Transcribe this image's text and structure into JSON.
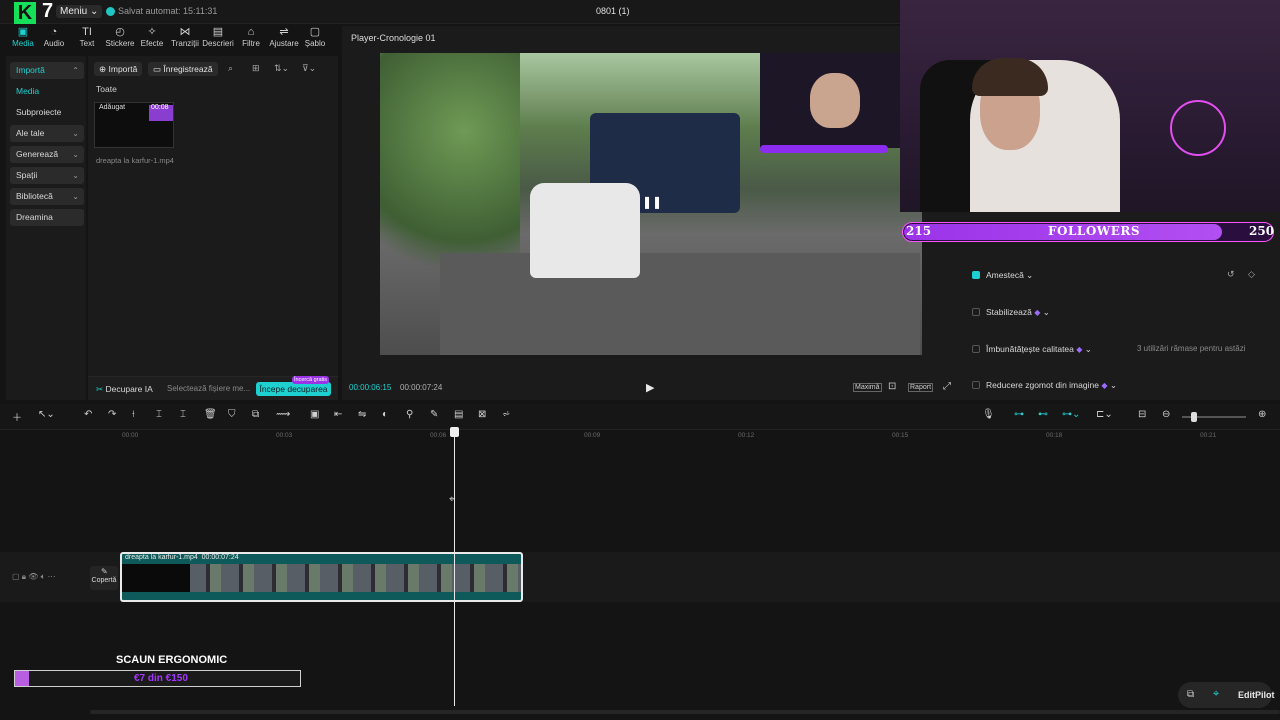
{
  "topbar": {
    "logo_letter": "K",
    "logo_number": "7",
    "menu_label": "Meniu",
    "autosave_label": "Salvat automat: 15:11:31",
    "project_title": "0801 (1)"
  },
  "tool_tabs": [
    {
      "label": "Media",
      "icon": "media-icon"
    },
    {
      "label": "Audio",
      "icon": "audio-icon"
    },
    {
      "label": "Text",
      "icon": "text-icon"
    },
    {
      "label": "Stickere",
      "icon": "sticker-icon"
    },
    {
      "label": "Efecte",
      "icon": "effects-icon"
    },
    {
      "label": "Tranziții",
      "icon": "transitions-icon"
    },
    {
      "label": "Descrieri",
      "icon": "captions-icon"
    },
    {
      "label": "Filtre",
      "icon": "filters-icon"
    },
    {
      "label": "Ajustare",
      "icon": "adjust-icon"
    },
    {
      "label": "Șablo",
      "icon": "templates-icon"
    }
  ],
  "left_nav": [
    {
      "label": "Importă"
    },
    {
      "label": "Media"
    },
    {
      "label": "Subproiecte"
    },
    {
      "label": "Ale tale"
    },
    {
      "label": "Generează"
    },
    {
      "label": "Spații"
    },
    {
      "label": "Bibliotecă"
    },
    {
      "label": "Dreamina"
    }
  ],
  "media_panel": {
    "import_label": "Importă",
    "record_label": "Înregistrează",
    "filter_label": "Toate",
    "thumb_badge": "Adăugat",
    "thumb_duration": "00:08",
    "file_name": "dreapta la karfur-1.mp4",
    "ai_cut_label": "Decupare IA",
    "select_files_label": "Selectează fișiere me...",
    "start_cut_label": "Începe decuparea",
    "free_badge": "Încercă gratis"
  },
  "preview": {
    "title": "Player-Cronologie 01",
    "current_time": "00:00:06:15",
    "duration": "00:00:07:24",
    "max_label": "Maximă",
    "ratio_label": "Raport"
  },
  "followers": {
    "current": "215",
    "label": "FOLLOWERS",
    "goal": "250",
    "progress": 0.86
  },
  "properties": [
    {
      "label": "Amestecă",
      "checked": true,
      "note": ""
    },
    {
      "label": "Stabilizează",
      "checked": false,
      "note": ""
    },
    {
      "label": "Îmbunătățește calitatea",
      "checked": false,
      "note": "3 utilizări rămase pentru astăzi"
    },
    {
      "label": "Reducere zgomot din imagine",
      "checked": false,
      "note": ""
    }
  ],
  "timeline": {
    "ruler_ticks": [
      "00:00",
      "00:03",
      "00:06",
      "00:09",
      "00:12",
      "00:15",
      "00:18",
      "00:21"
    ],
    "clip_name": "dreapta la karfur-1.mp4",
    "clip_duration": "00:00:07:24",
    "cover_label": "Copertă"
  },
  "overlay": {
    "chair_title": "SCAUN ERGONOMIC",
    "goal_text": "€7 din €150",
    "goal_progress": 0.047
  },
  "copilot": {
    "label": "EditPilot"
  },
  "colors": {
    "accent": "#1fd0d0",
    "followers_bar": "#9b33e8",
    "goal_fill": "#b75fe0",
    "background": "#141414"
  }
}
